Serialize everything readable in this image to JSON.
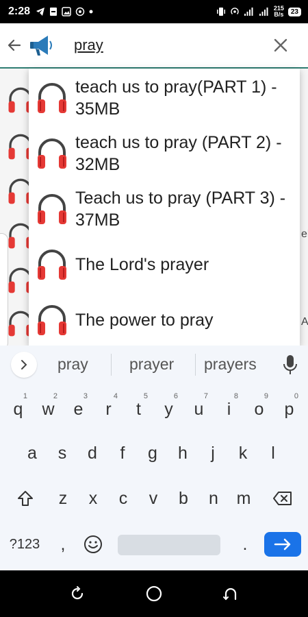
{
  "status": {
    "time": "2:28",
    "speed_top": "215",
    "speed_bottom": "B/s",
    "battery": "23"
  },
  "search": {
    "query": "pray",
    "back_icon": "arrow-left-icon",
    "app_icon": "megaphone-icon",
    "clear_icon": "close-icon"
  },
  "suggestions": [
    {
      "label": "teach us to pray(PART 1) - 35MB",
      "icon": "headphones-icon"
    },
    {
      "label": "teach us to pray (PART 2) - 32MB",
      "icon": "headphones-icon"
    },
    {
      "label": "Teach us to pray (PART 3) - 37MB",
      "icon": "headphones-icon"
    },
    {
      "label": "The Lord's prayer",
      "icon": "headphones-icon"
    },
    {
      "label": "The power to pray",
      "icon": "headphones-icon"
    }
  ],
  "background": {
    "edge_text_1": "el",
    "edge_text_2": "A"
  },
  "keyboard": {
    "word_suggestions": [
      "pray",
      "prayer",
      "prayers"
    ],
    "row1": [
      {
        "key": "q",
        "num": "1"
      },
      {
        "key": "w",
        "num": "2"
      },
      {
        "key": "e",
        "num": "3"
      },
      {
        "key": "r",
        "num": "4"
      },
      {
        "key": "t",
        "num": "5"
      },
      {
        "key": "y",
        "num": "6"
      },
      {
        "key": "u",
        "num": "7"
      },
      {
        "key": "i",
        "num": "8"
      },
      {
        "key": "o",
        "num": "9"
      },
      {
        "key": "p",
        "num": "0"
      }
    ],
    "row2": [
      "a",
      "s",
      "d",
      "f",
      "g",
      "h",
      "j",
      "k",
      "l"
    ],
    "row3": [
      "z",
      "x",
      "c",
      "v",
      "b",
      "n",
      "m"
    ],
    "symbols_label": "?123",
    "comma": ",",
    "period": ".",
    "emoji_icon": "emoji-icon",
    "shift_icon": "shift-icon",
    "backspace_icon": "backspace-icon",
    "enter_icon": "arrow-right-icon",
    "mic_icon": "mic-icon",
    "expand_label": ">"
  },
  "colors": {
    "accent": "#2e7d72",
    "headphone_red": "#e53935",
    "enter_blue": "#1a73e8"
  }
}
